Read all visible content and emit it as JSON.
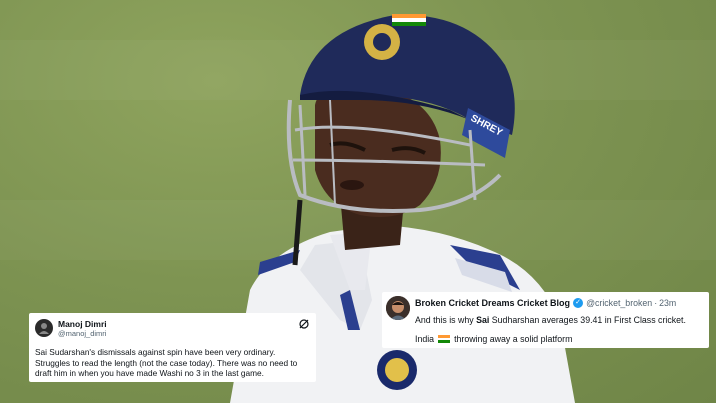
{
  "tweet1": {
    "name": "Manoj Dimri",
    "handle": "@manoj_dimri",
    "text_line1": "Sai Sudarshan's dismissals against spin have been very ordinary.",
    "text_line2": "Struggles to read the length (not the case today). There was no need to",
    "text_line3": "draft him in when you have made Washi no 3 in the last game."
  },
  "tweet2": {
    "name": "Broken Cricket Dreams Cricket Blog",
    "handle": "@cricket_broken",
    "time": "23m",
    "sep": "·",
    "text_pre": "And this is why ",
    "text_bold": "Sai",
    "text_post": " Sudharshan averages 39.41 in First Class cricket.",
    "line2_pre": "India",
    "line2_post": "throwing away a solid platform"
  },
  "helmet_label": "SHREY",
  "colors": {
    "grass": "#7e9452",
    "helmet": "#1f2a5a",
    "tweet_bg": "#ffffff",
    "verified": "#1d9bf0"
  }
}
